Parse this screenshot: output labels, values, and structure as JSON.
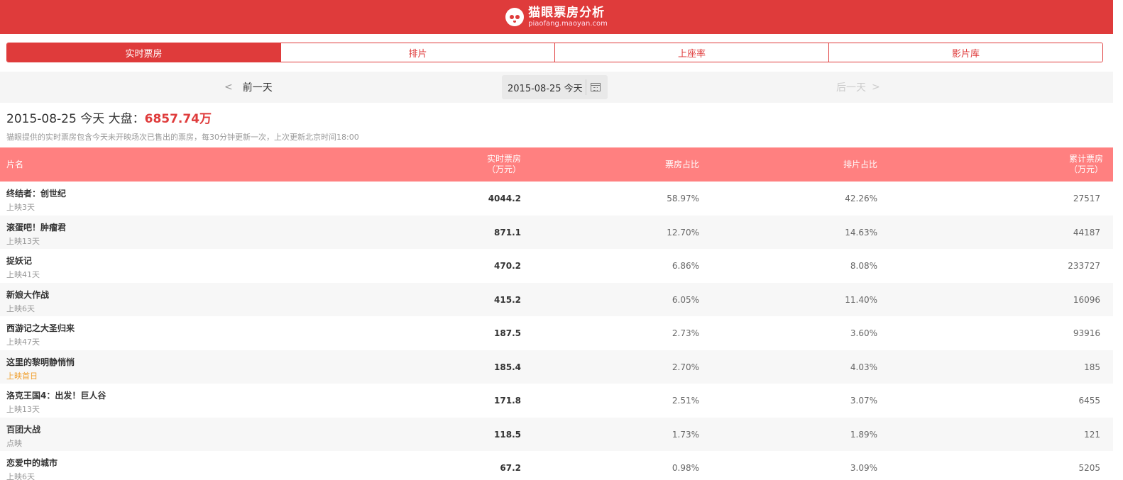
{
  "brand": {
    "title": "猫眼票房分析",
    "subtitle": "piaofang.maoyan.com"
  },
  "tabs": [
    {
      "label": "实时票房",
      "active": true
    },
    {
      "label": "排片",
      "active": false
    },
    {
      "label": "上座率",
      "active": false
    },
    {
      "label": "影片库",
      "active": false
    }
  ],
  "datebar": {
    "prev": "前一天",
    "date": "2015-08-25 今天",
    "next": "后一天"
  },
  "summary": {
    "title_prefix": "2015-08-25 今天 大盘：",
    "amount": "6857.74万",
    "note": "猫眼提供的实时票房包含今天未开映场次已售出的票房，每30分钟更新一次，上次更新北京时间18:00"
  },
  "table": {
    "headers": {
      "name": "片名",
      "realtime_line1": "实时票房",
      "realtime_line2": "（万元）",
      "share": "票房占比",
      "schedule": "排片占比",
      "total_line1": "累计票房",
      "total_line2": "（万元）"
    },
    "rows": [
      {
        "name": "终结者：创世纪",
        "days": "上映3天",
        "realtime": "4044.2",
        "share": "58.97%",
        "schedule": "42.26%",
        "total": "27517"
      },
      {
        "name": "滚蛋吧！肿瘤君",
        "days": "上映13天",
        "realtime": "871.1",
        "share": "12.70%",
        "schedule": "14.63%",
        "total": "44187"
      },
      {
        "name": "捉妖记",
        "days": "上映41天",
        "realtime": "470.2",
        "share": "6.86%",
        "schedule": "8.08%",
        "total": "233727"
      },
      {
        "name": "新娘大作战",
        "days": "上映6天",
        "realtime": "415.2",
        "share": "6.05%",
        "schedule": "11.40%",
        "total": "16096"
      },
      {
        "name": "西游记之大圣归来",
        "days": "上映47天",
        "realtime": "187.5",
        "share": "2.73%",
        "schedule": "3.60%",
        "total": "93916"
      },
      {
        "name": "这里的黎明静悄悄",
        "days": "上映首日",
        "realtime": "185.4",
        "share": "2.70%",
        "schedule": "4.03%",
        "total": "185"
      },
      {
        "name": "洛克王国4：出发！巨人谷",
        "days": "上映13天",
        "realtime": "171.8",
        "share": "2.51%",
        "schedule": "3.07%",
        "total": "6455"
      },
      {
        "name": "百团大战",
        "days": "点映",
        "realtime": "118.5",
        "share": "1.73%",
        "schedule": "1.89%",
        "total": "121"
      },
      {
        "name": "恋爱中的城市",
        "days": "上映6天",
        "realtime": "67.2",
        "share": "0.98%",
        "schedule": "3.09%",
        "total": "5205"
      }
    ]
  },
  "colors": {
    "brand_red": "#df3b3b",
    "header_pink": "#ff8080",
    "first_day_orange": "#f0a030"
  },
  "icons": {
    "logo": "cat-eye-logo-icon",
    "calendar": "calendar-icon",
    "prev": "chevron-left-icon",
    "next": "chevron-right-icon"
  }
}
